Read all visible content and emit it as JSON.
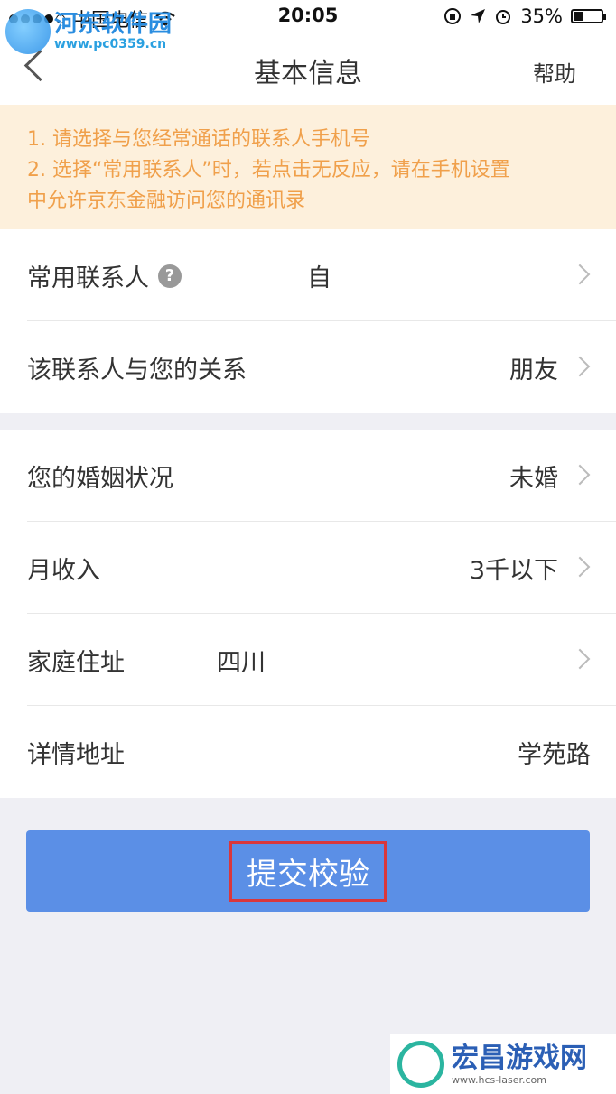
{
  "status_bar": {
    "carrier": "中国电信",
    "time": "20:05",
    "battery_percent": "35%",
    "battery_level": 0.35,
    "icons": [
      "signal-dots-icon",
      "wifi-icon",
      "rotation-lock-icon",
      "location-arrow-icon",
      "alarm-icon",
      "battery-icon"
    ]
  },
  "watermark_top": {
    "name": "河东软件园",
    "url": "www.pc0359.cn"
  },
  "nav": {
    "title": "基本信息",
    "help": "帮助",
    "back_icon": "chevron-left-icon"
  },
  "notice": {
    "lines": [
      "1. 请选择与您经常通话的联系人手机号",
      "2. 选择“常用联系人”时，若点击无反应，请在手机设置",
      "中允许京东金融访问您的通讯录"
    ]
  },
  "form": {
    "contact": {
      "label": "常用联系人",
      "value": "自"
    },
    "relation": {
      "label": "该联系人与您的关系",
      "value": "朋友"
    },
    "marital": {
      "label": "您的婚姻状况",
      "value": "未婚"
    },
    "income": {
      "label": "月收入",
      "value": "3千以下"
    },
    "address": {
      "label": "家庭住址",
      "value": "四川"
    },
    "detail": {
      "label": "详情地址",
      "value": "学苑路"
    }
  },
  "submit": {
    "label": "提交校验"
  },
  "watermark_bottom": {
    "name": "宏昌游戏网",
    "url": "www.hcs-laser.com"
  },
  "colors": {
    "accent": "#5b8fe6",
    "notice_bg": "#fdf0dc",
    "notice_text": "#f0a04b",
    "highlight_border": "#d9373b",
    "page_bg": "#efeff4"
  }
}
